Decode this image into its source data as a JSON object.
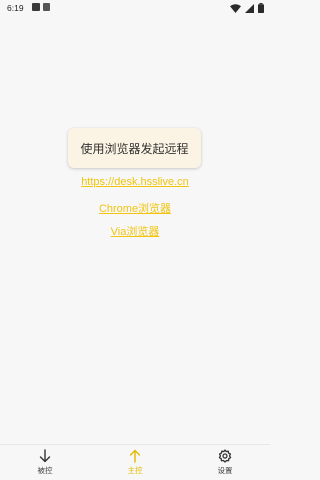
{
  "status_bar": {
    "time": "6:19",
    "app_icons": [
      "notification-app-icon",
      "notification-app-icon-2"
    ],
    "right_icons": [
      "wifi-icon",
      "signal-icon",
      "battery-icon"
    ]
  },
  "main": {
    "primary_action_label": "使用浏览器发起远程",
    "links": [
      {
        "label": "https://desk.hsslive.cn"
      },
      {
        "label": "Chrome浏览器"
      },
      {
        "label": "Via浏览器"
      }
    ]
  },
  "bottom_nav": {
    "items": [
      {
        "label": "被控",
        "icon": "arrow-down-icon",
        "active": false
      },
      {
        "label": "主控",
        "icon": "arrow-up-icon",
        "active": true
      },
      {
        "label": "设置",
        "icon": "gear-icon",
        "active": false
      }
    ]
  },
  "colors": {
    "accent": "#f1c40f",
    "active_tab": "#e6b800",
    "card_background": "#fbf3e3",
    "page_background": "#f7f7f7"
  }
}
